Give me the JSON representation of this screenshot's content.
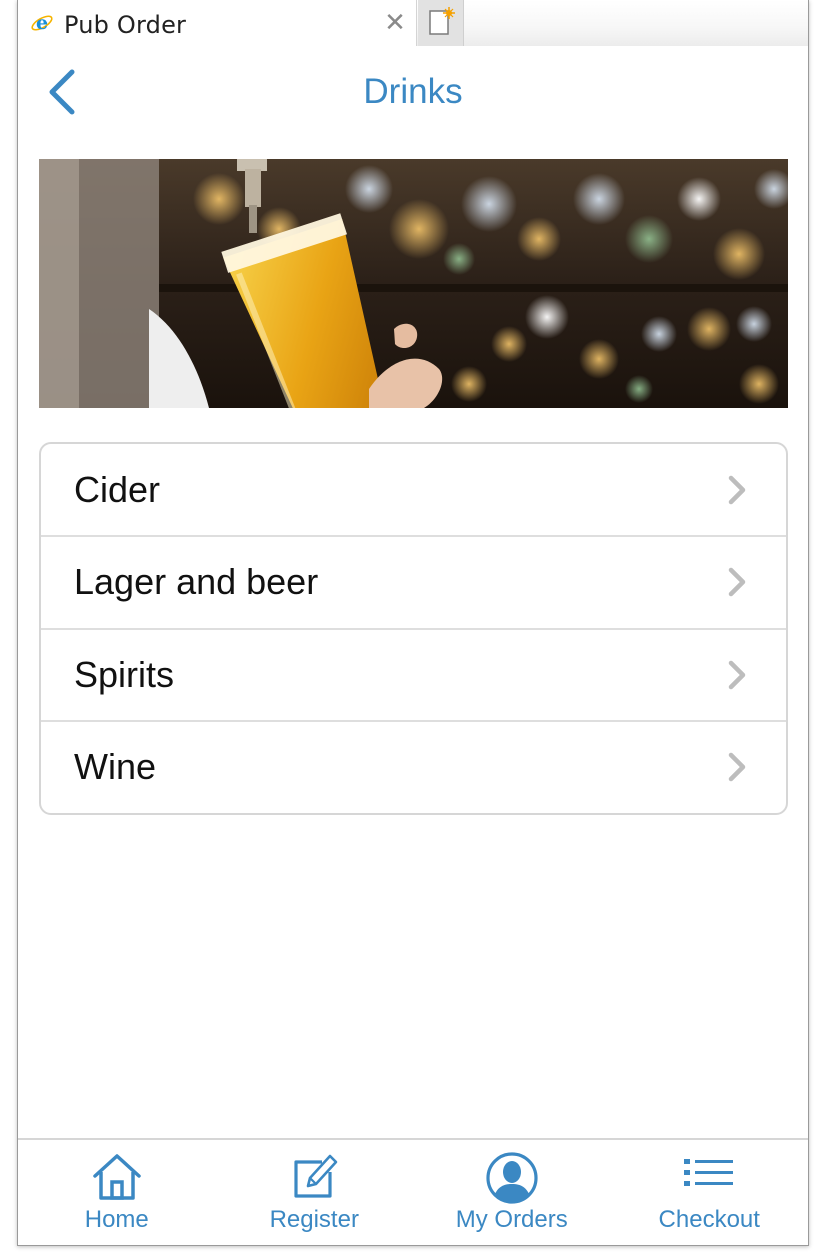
{
  "browser": {
    "tab_title": "Pub Order",
    "close_glyph": "✕"
  },
  "header": {
    "title": "Drinks",
    "back_icon": "chevron-left-icon"
  },
  "hero": {
    "icon": "beer-pour-photo"
  },
  "categories": [
    {
      "label": "Cider"
    },
    {
      "label": "Lager and beer"
    },
    {
      "label": "Spirits"
    },
    {
      "label": "Wine"
    }
  ],
  "nav": [
    {
      "label": "Home",
      "icon": "home-icon"
    },
    {
      "label": "Register",
      "icon": "edit-icon"
    },
    {
      "label": "My Orders",
      "icon": "user-icon"
    },
    {
      "label": "Checkout",
      "icon": "list-icon"
    }
  ],
  "colors": {
    "accent": "#3b88c3",
    "chevron": "#bdbdbd",
    "border": "#d6d6d6"
  }
}
